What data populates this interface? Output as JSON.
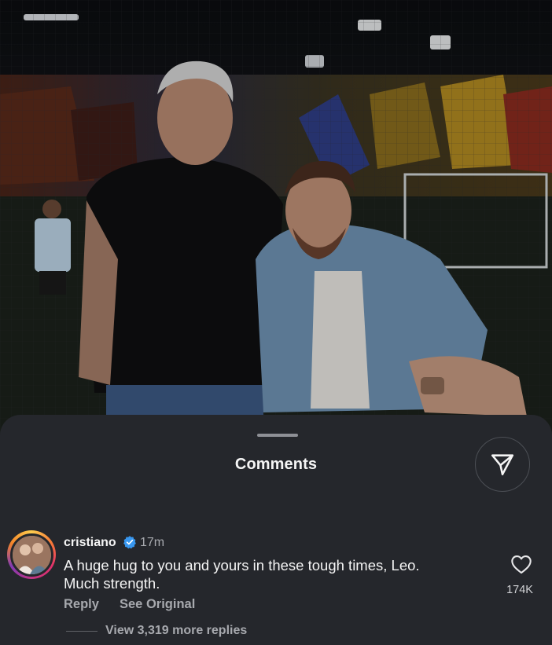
{
  "post": {
    "image_description_icon": "photo"
  },
  "sheet": {
    "title": "Comments",
    "share_icon": "send-icon"
  },
  "comment": {
    "username": "cristiano",
    "verified_icon": "verified-badge-icon",
    "time": "17m",
    "text_line1": "A huge hug to you and yours in these tough times, Leo.",
    "text_line2": "Much strength.",
    "reply_label": "Reply",
    "see_original_label": "See Original",
    "like_icon": "heart-icon",
    "like_count": "174K",
    "view_replies_label": "View 3,319 more replies"
  },
  "colors": {
    "sheet_bg": "#25272c",
    "text_primary": "#f5f5f5",
    "text_secondary": "#a7a9ae",
    "verified_blue": "#3897f0"
  }
}
